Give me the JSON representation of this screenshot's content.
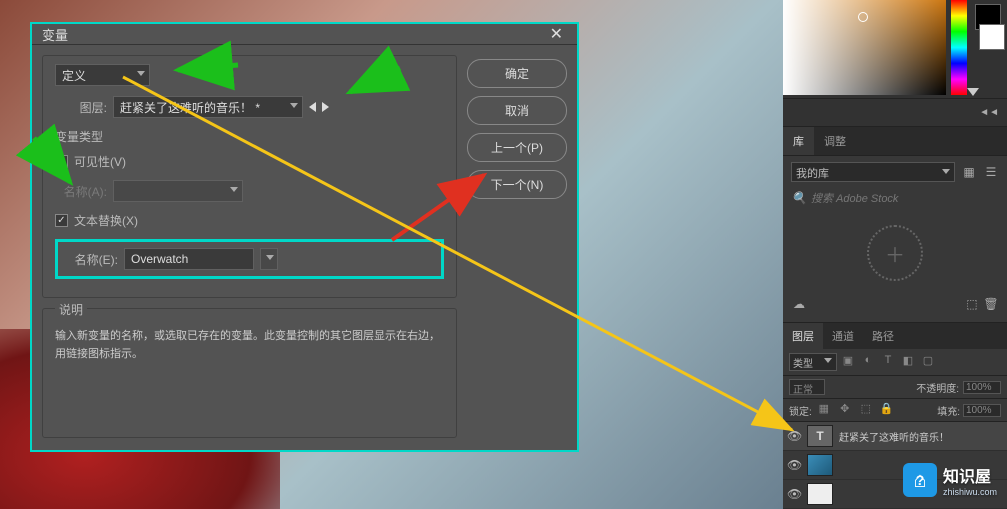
{
  "dialog": {
    "title": "变量",
    "define_label": "定义",
    "layer_label": "图层:",
    "layer_value": "赶紧关了这难听的音乐！ *",
    "vartype_label": "变量类型",
    "visibility_label": "可见性(V)",
    "name_a_label": "名称(A):",
    "textreplace_label": "文本替换(X)",
    "name_e_label": "名称(E):",
    "name_e_value": "Overwatch",
    "desc_title": "说明",
    "desc_text": "输入新变量的名称，或选取已存在的变量。此变量控制的其它图层显示在右边，用链接图标指示。"
  },
  "buttons": {
    "ok": "确定",
    "cancel": "取消",
    "prev": "上一个(P)",
    "next": "下一个(N)"
  },
  "sidebar": {
    "tab_lib": "库",
    "tab_adjust": "调整",
    "lib_select": "我的库",
    "search_placeholder": "搜索 Adobe Stock",
    "layers_tab": "图层",
    "channels_tab": "通道",
    "paths_tab": "路径",
    "filter_kind": "类型",
    "blend_mode": "正常",
    "opacity_label": "不透明度:",
    "opacity_value": "100%",
    "lock_label": "锁定:",
    "fill_label": "填充:",
    "fill_value": "100%",
    "layers": [
      {
        "name": "赶紧关了这难听的音乐！",
        "type": "text"
      },
      {
        "name": "",
        "type": "img"
      },
      {
        "name": "",
        "type": "bg"
      }
    ]
  },
  "brand": {
    "name": "知识屋",
    "url": "zhishiwu.com"
  }
}
